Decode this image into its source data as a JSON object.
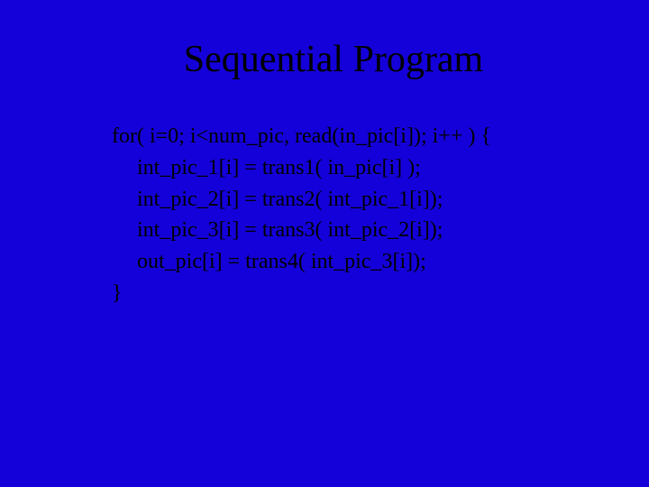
{
  "title": "Sequential Program",
  "code": {
    "l0": "for( i=0; i<num_pic, read(in_pic[i]); i++ ) {",
    "l1": "int_pic_1[i] = trans1( in_pic[i] );",
    "l2": "int_pic_2[i] = trans2( int_pic_1[i]);",
    "l3": "int_pic_3[i] = trans3( int_pic_2[i]);",
    "l4": "out_pic[i] = trans4( int_pic_3[i]);",
    "l5": "}"
  }
}
